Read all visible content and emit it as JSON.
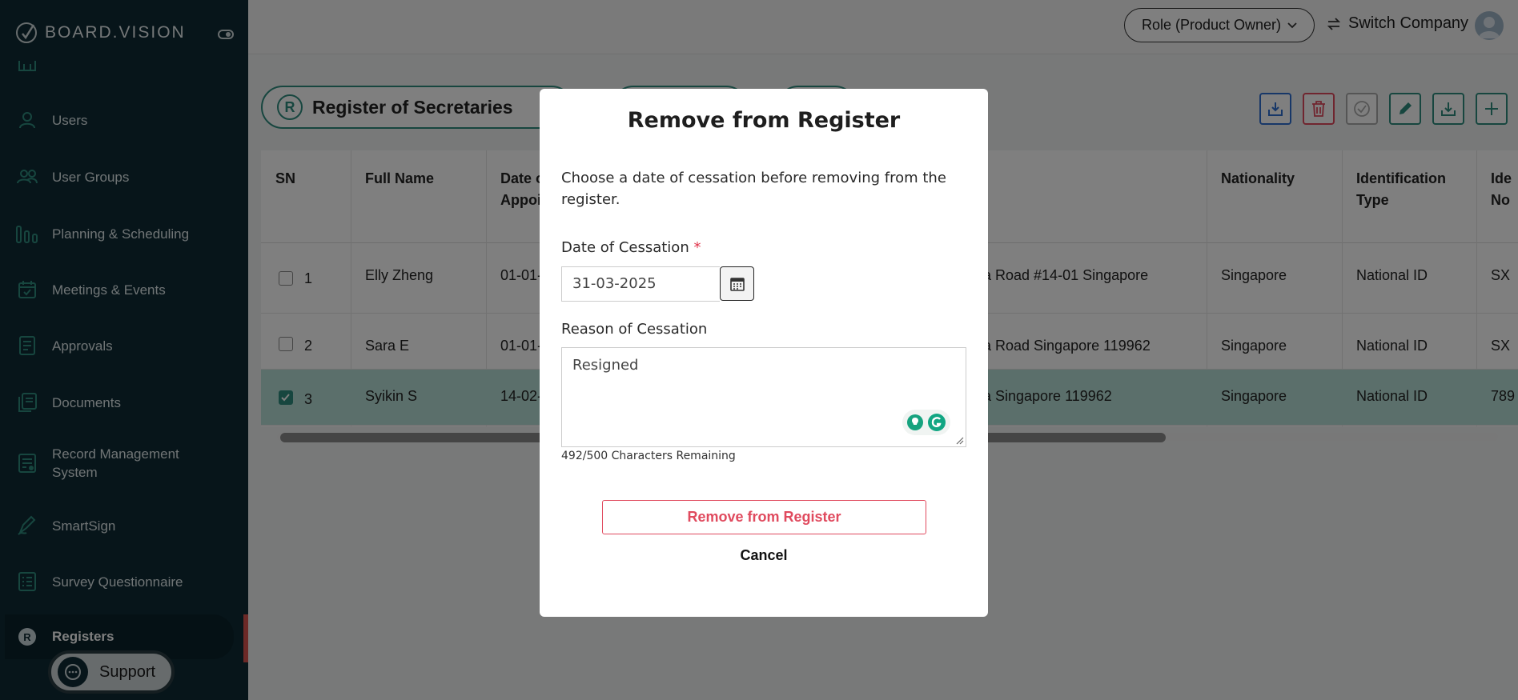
{
  "sidebar": {
    "logo": "BOARD.VISION",
    "items": [
      {
        "label": "Users",
        "icon": "user-icon"
      },
      {
        "label": "User Groups",
        "icon": "users-icon"
      },
      {
        "label": "Planning & Scheduling",
        "icon": "bar-chart-icon"
      },
      {
        "label": "Meetings & Events",
        "icon": "calendar-icon"
      },
      {
        "label": "Approvals",
        "icon": "document-icon"
      },
      {
        "label": "Documents",
        "icon": "documents-icon"
      },
      {
        "label": "Record Management\nSystem",
        "icon": "record-icon"
      },
      {
        "label": "SmartSign",
        "icon": "pen-icon"
      },
      {
        "label": "Survey Questionnaire",
        "icon": "survey-icon"
      },
      {
        "label": "Registers",
        "icon": "register-icon",
        "active": true
      }
    ],
    "support_label": "Support"
  },
  "header": {
    "role_label": "Role (Product Owner)",
    "switch_label": "Switch Company"
  },
  "register": {
    "title": "Register of Secretaries",
    "columns": [
      "SN",
      "Full Name",
      "Date of\nAppoi",
      "Nationality",
      "Identification\nType",
      "Ide\nNo"
    ],
    "rows": [
      {
        "sn": "1",
        "name": "Elly Zheng",
        "date": "01-01-",
        "address": "ra Road #14-01 Singapore",
        "nationality": "Singapore",
        "id_type": "National ID",
        "id_no": "SX",
        "selected": false
      },
      {
        "sn": "2",
        "name": "Sara E",
        "date": "01-01-",
        "address": "ra Road Singapore 119962",
        "nationality": "Singapore",
        "id_type": "National ID",
        "id_no": "SX",
        "selected": false
      },
      {
        "sn": "3",
        "name": "Syikin S",
        "date": "14-02-",
        "address": "ra Singapore 119962",
        "nationality": "Singapore",
        "id_type": "National ID",
        "id_no": "789",
        "selected": true
      }
    ]
  },
  "modal": {
    "title": "Remove from Register",
    "description": "Choose a date of cessation before removing from the register.",
    "date_label": "Date of Cessation",
    "required_mark": "*",
    "date_value": "31-03-2025",
    "reason_label": "Reason of Cessation",
    "reason_value": "Resigned",
    "counter": "492/500 Characters Remaining",
    "remove_label": "Remove from Register",
    "cancel_label": "Cancel"
  },
  "colors": {
    "sidebar_bg": "#0f2b35",
    "accent": "#2e8c7f",
    "danger": "#e04a5e",
    "selected_row": "#b7ded6"
  }
}
